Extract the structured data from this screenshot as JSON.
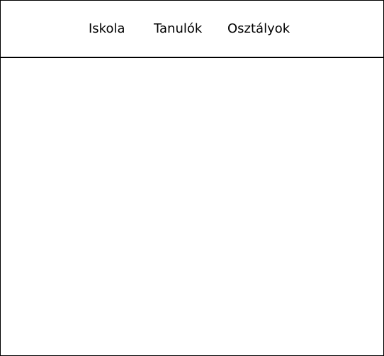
{
  "nav": {
    "items": [
      {
        "label": "Iskola"
      },
      {
        "label": "Tanulók"
      },
      {
        "label": "Osztályok"
      }
    ]
  }
}
